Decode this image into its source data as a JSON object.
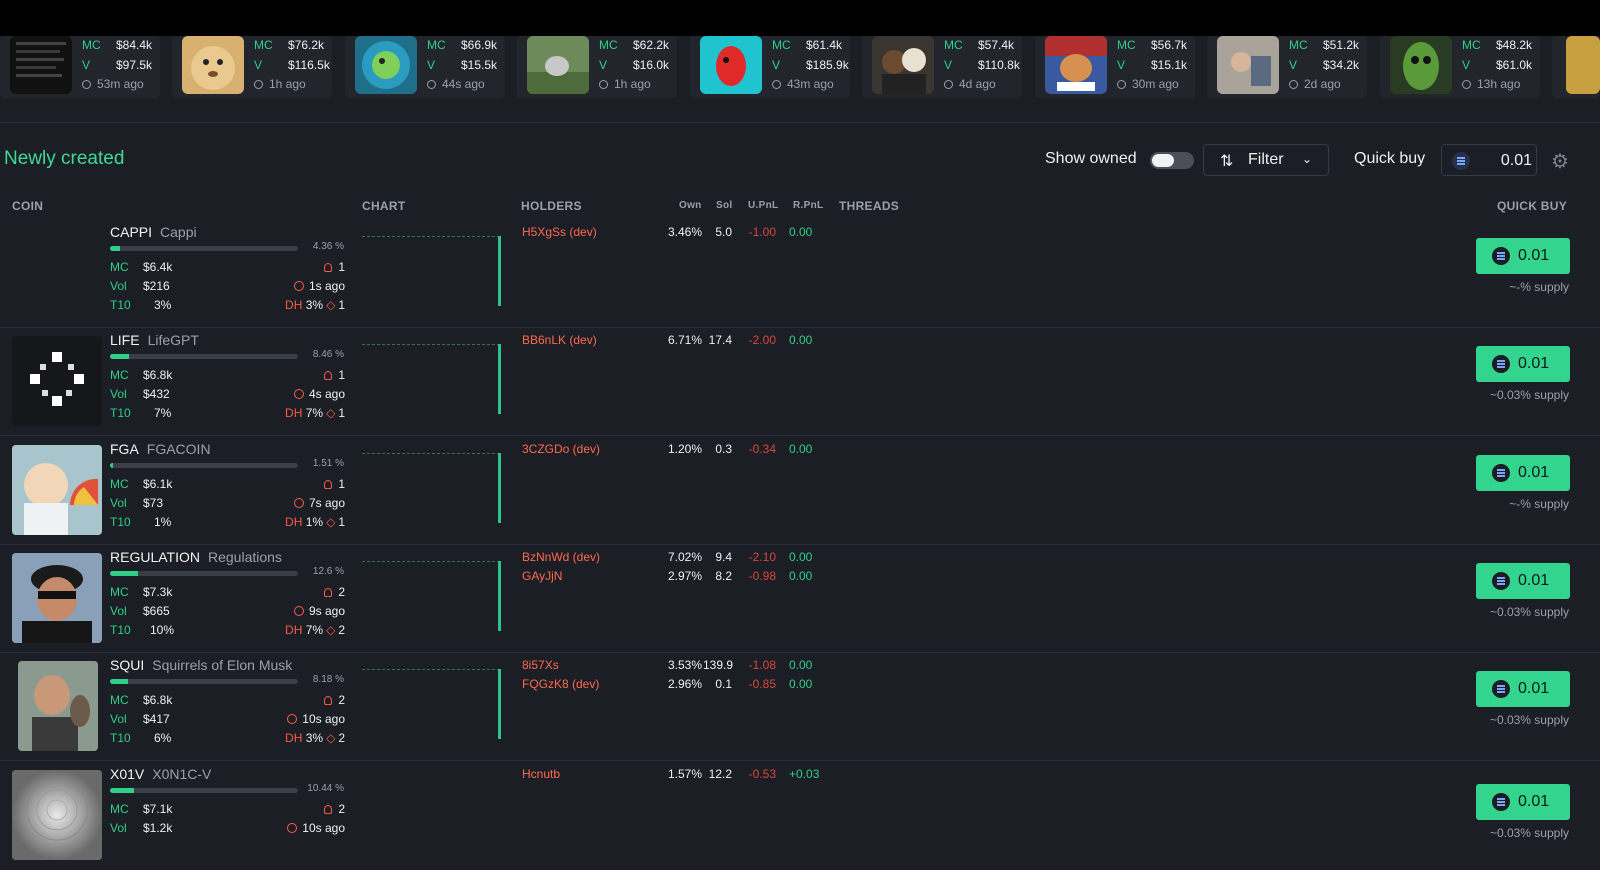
{
  "trending": [
    {
      "mc": "$84.4k",
      "v": "$97.5k",
      "ago": "53m ago"
    },
    {
      "mc": "$76.2k",
      "v": "$116.5k",
      "ago": "1h ago"
    },
    {
      "mc": "$66.9k",
      "v": "$15.5k",
      "ago": "44s ago"
    },
    {
      "mc": "$62.2k",
      "v": "$16.0k",
      "ago": "1h ago"
    },
    {
      "mc": "$61.4k",
      "v": "$185.9k",
      "ago": "43m ago"
    },
    {
      "mc": "$57.4k",
      "v": "$110.8k",
      "ago": "4d ago"
    },
    {
      "mc": "$56.7k",
      "v": "$15.1k",
      "ago": "30m ago"
    },
    {
      "mc": "$51.2k",
      "v": "$34.2k",
      "ago": "2d ago"
    },
    {
      "mc": "$48.2k",
      "v": "$61.0k",
      "ago": "13h ago"
    }
  ],
  "labels": {
    "mc": "MC",
    "v": "V",
    "vol": "Vol",
    "t10": "T10",
    "dh": "DH"
  },
  "section": {
    "title": "Newly created",
    "show_owned": "Show owned",
    "filter": "Filter",
    "quick_buy": "Quick buy",
    "quick_buy_value": "0.01"
  },
  "columns": {
    "coin": "COIN",
    "chart": "CHART",
    "holders": "HOLDERS",
    "own": "Own",
    "sol": "Sol",
    "upnl": "U.PnL",
    "rpnl": "R.PnL",
    "threads": "THREADS",
    "quick_buy": "QUICK BUY"
  },
  "colors": {
    "accent": "#2fcf8a",
    "danger": "#ff5a47",
    "background": "#1b1e24"
  },
  "coins": [
    {
      "ticker": "CAPPI",
      "name": "Cappi",
      "progress_pct": 4.36,
      "pct": "4.36 %",
      "mc": "$6.4k",
      "vol": "$216",
      "t10": "3%",
      "holders_count": "1",
      "age": "1s ago",
      "dh": "3%",
      "dh_count": "1",
      "holders": [
        {
          "name": "H5XgSs (dev)",
          "own": "3.46%",
          "sol": "5.0",
          "upnl": "-1.00",
          "rpnl": "0.00"
        }
      ],
      "buy": "0.01",
      "supply": "~-% supply"
    },
    {
      "ticker": "LIFE",
      "name": "LifeGPT",
      "progress_pct": 8.46,
      "pct": "8.46 %",
      "mc": "$6.8k",
      "vol": "$432",
      "t10": "7%",
      "holders_count": "1",
      "age": "4s ago",
      "dh": "7%",
      "dh_count": "1",
      "holders": [
        {
          "name": "BB6nLK (dev)",
          "own": "6.71%",
          "sol": "17.4",
          "upnl": "-2.00",
          "rpnl": "0.00"
        }
      ],
      "buy": "0.01",
      "supply": "~0.03% supply"
    },
    {
      "ticker": "FGA",
      "name": "FGACOIN",
      "progress_pct": 1.51,
      "pct": "1.51 %",
      "mc": "$6.1k",
      "vol": "$73",
      "t10": "1%",
      "holders_count": "1",
      "age": "7s ago",
      "dh": "1%",
      "dh_count": "1",
      "holders": [
        {
          "name": "3CZGDo (dev)",
          "own": "1.20%",
          "sol": "0.3",
          "upnl": "-0.34",
          "rpnl": "0.00"
        }
      ],
      "buy": "0.01",
      "supply": "~-% supply"
    },
    {
      "ticker": "REGULATION",
      "name": "Regulations",
      "progress_pct": 12.6,
      "pct": "12.6 %",
      "mc": "$7.3k",
      "vol": "$665",
      "t10": "10%",
      "holders_count": "2",
      "age": "9s ago",
      "dh": "7%",
      "dh_count": "2",
      "holders": [
        {
          "name": "BzNnWd (dev)",
          "own": "7.02%",
          "sol": "9.4",
          "upnl": "-2.10",
          "rpnl": "0.00"
        },
        {
          "name": "GAyJjN",
          "own": "2.97%",
          "sol": "8.2",
          "upnl": "-0.98",
          "rpnl": "0.00"
        }
      ],
      "buy": "0.01",
      "supply": "~0.03% supply"
    },
    {
      "ticker": "SQUI",
      "name": "Squirrels of Elon Musk",
      "progress_pct": 8.18,
      "pct": "8.18 %",
      "mc": "$6.8k",
      "vol": "$417",
      "t10": "6%",
      "holders_count": "2",
      "age": "10s ago",
      "dh": "3%",
      "dh_count": "2",
      "holders": [
        {
          "name": "8i57Xs",
          "own": "3.53%",
          "sol": "139.9",
          "upnl": "-1.08",
          "rpnl": "0.00"
        },
        {
          "name": "FQGzK8 (dev)",
          "own": "2.96%",
          "sol": "0.1",
          "upnl": "-0.85",
          "rpnl": "0.00"
        }
      ],
      "buy": "0.01",
      "supply": "~0.03% supply"
    },
    {
      "ticker": "X01V",
      "name": "X0N1C-V",
      "progress_pct": 10.44,
      "pct": "10.44 %",
      "mc": "$7.1k",
      "vol": "$1.2k",
      "t10": "",
      "holders_count": "2",
      "age": "10s ago",
      "dh": "",
      "dh_count": "",
      "holders": [
        {
          "name": "Hcnutb",
          "own": "1.57%",
          "sol": "12.2",
          "upnl": "-0.53",
          "rpnl": "+0.03"
        }
      ],
      "buy": "0.01",
      "supply": "~0.03% supply"
    }
  ]
}
